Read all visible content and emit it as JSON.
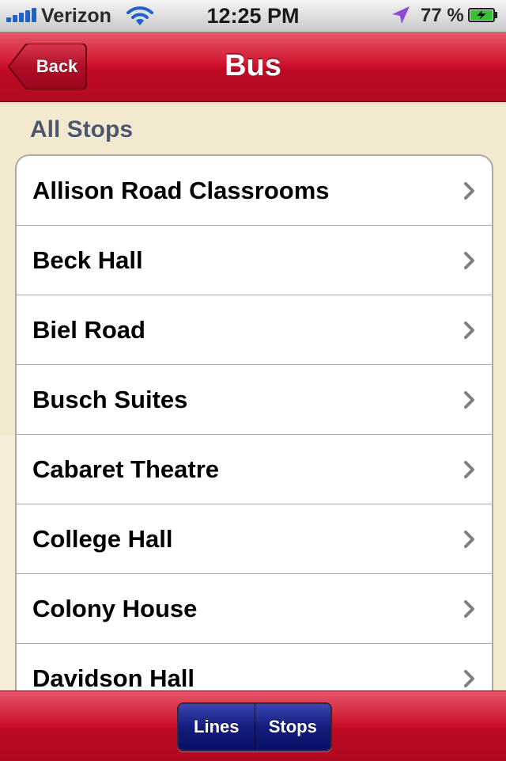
{
  "status_bar": {
    "carrier": "Verizon",
    "time": "12:25 PM",
    "battery": "77 %",
    "signal_bars": 5,
    "icons": [
      "signal-icon",
      "wifi-icon",
      "location-arrow-icon",
      "battery-charging-icon"
    ]
  },
  "nav": {
    "back_label": "Back",
    "title": "Bus"
  },
  "section": {
    "header": "All Stops"
  },
  "stops": [
    "Allison Road Classrooms",
    "Beck Hall",
    "Biel Road",
    "Busch Suites",
    "Cabaret Theatre",
    "College Hall",
    "Colony House",
    "Davidson Hall"
  ],
  "tabs": {
    "lines_label": "Lines",
    "stops_label": "Stops"
  },
  "colors": {
    "nav_red": "#c8102e",
    "background": "#f3e9cf",
    "section_header": "#4c566d",
    "segment_blue": "#141c7d",
    "chevron": "#7f7f7f"
  }
}
